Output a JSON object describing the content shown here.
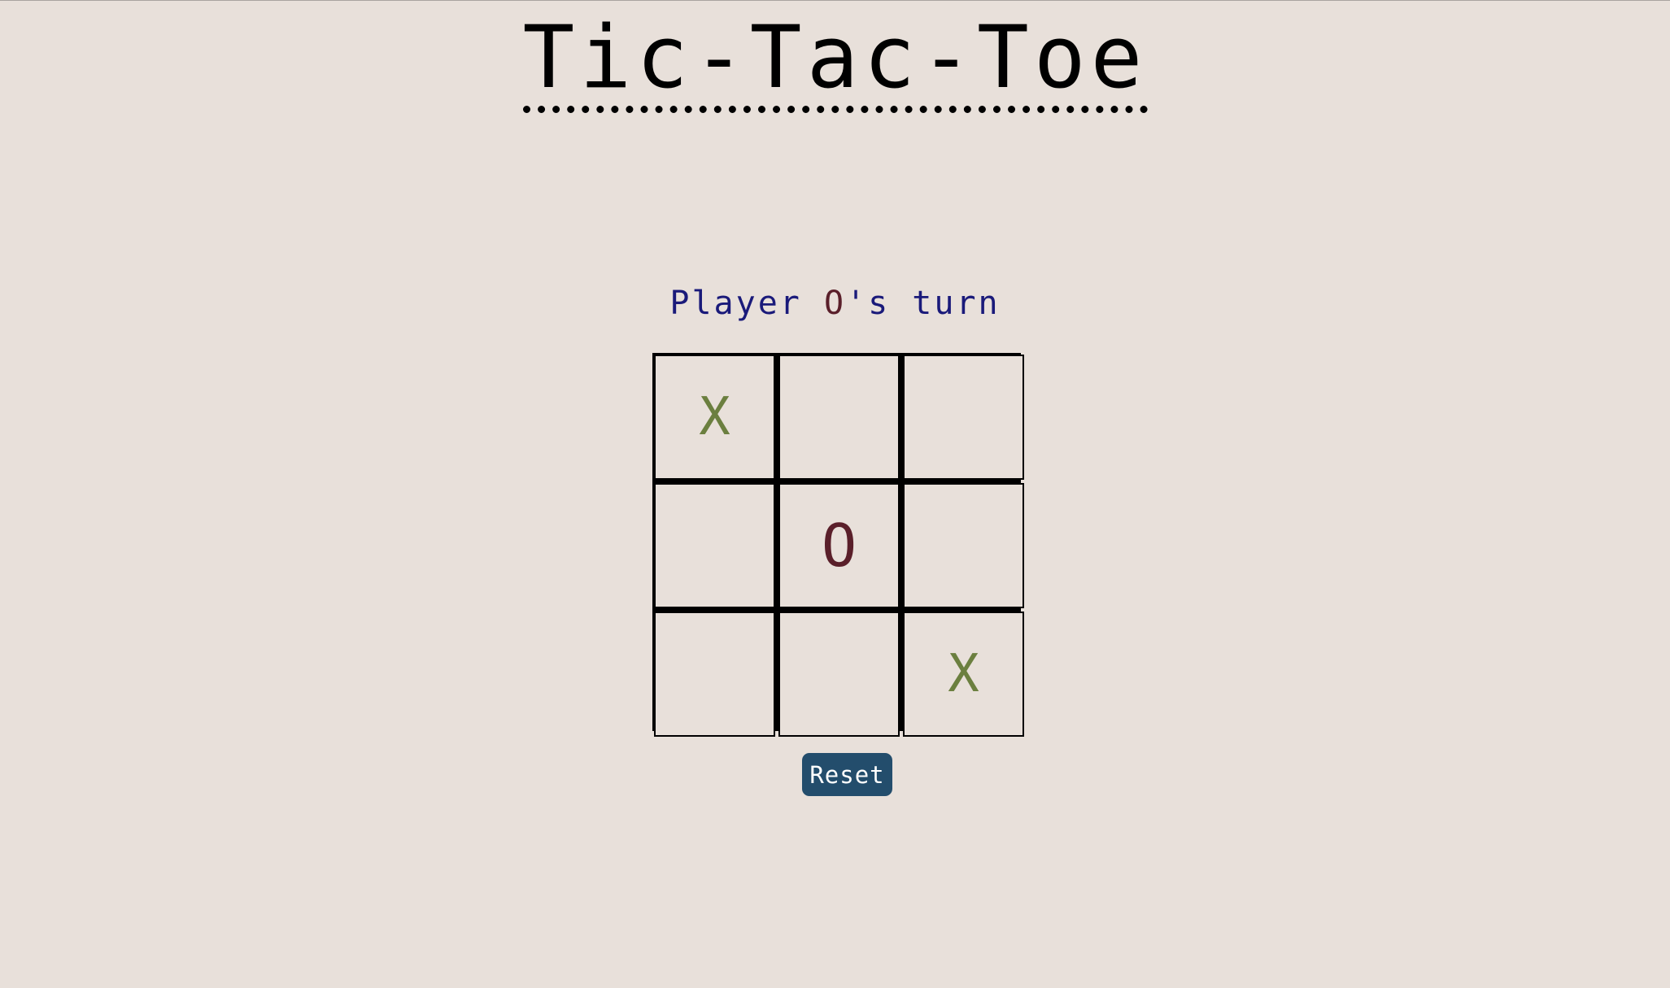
{
  "title": "Tic-Tac-Toe",
  "status": {
    "prefix": "Player ",
    "player": "O",
    "suffix": "'s turn"
  },
  "board": {
    "cells": [
      "X",
      "",
      "",
      "",
      "O",
      "",
      "",
      "",
      "X"
    ]
  },
  "reset_label": "Reset",
  "colors": {
    "background": "#e8e0da",
    "x_mark": "#6b7f3f",
    "o_mark": "#5a1f2a",
    "status_text": "#1a1a7a",
    "reset_button": "#234d6c"
  }
}
